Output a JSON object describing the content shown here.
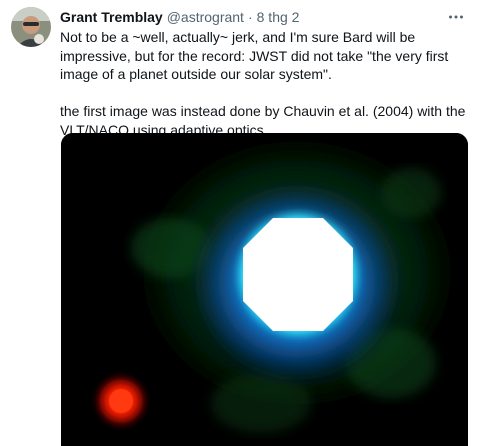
{
  "tweet": {
    "author": {
      "display_name": "Grant Tremblay",
      "handle": "@astrogrant",
      "separator": "·",
      "time": "8 thg 2"
    },
    "text_paragraph_1": "Not to be a ~well, actually~ jerk, and I'm sure Bard will be impressive, but for the record: JWST did not take \"the very first image of a planet outside our solar system\".",
    "text_paragraph_2": "the first image was instead done by Chauvin et al. (2004) with the VLT/NACO using adaptive optics.",
    "more_icon": "more-horizontal-icon",
    "media_description_icon": "astronomy-image"
  },
  "colors": {
    "text_primary": "#0f1419",
    "text_secondary": "#536471",
    "star_core": "#ffffff",
    "star_halo": "#2ff0ff",
    "planet": "#ff1a00",
    "background": "#000000"
  }
}
